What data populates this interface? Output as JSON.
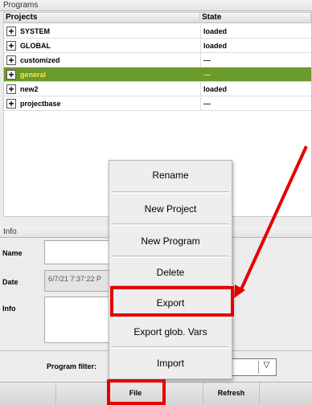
{
  "programs": {
    "title": "Programs",
    "columns": [
      "Projects",
      "State"
    ],
    "rows": [
      {
        "name": "SYSTEM",
        "state": "loaded",
        "selected": false
      },
      {
        "name": "GLOBAL",
        "state": "loaded",
        "selected": false
      },
      {
        "name": "customized",
        "state": "---",
        "selected": false
      },
      {
        "name": "general",
        "state": "---",
        "selected": true
      },
      {
        "name": "new2",
        "state": "loaded",
        "selected": false
      },
      {
        "name": "projectbase",
        "state": "---",
        "selected": false
      }
    ],
    "expander_symbol": "+"
  },
  "info": {
    "title": "Info",
    "name_label": "Name",
    "name_value": "",
    "date_label": "Date",
    "date_value": "6/7/21 7:37:22 P",
    "info_label": "Info",
    "info_value": ""
  },
  "filter": {
    "label": "Program filter:",
    "value": "",
    "arrow": "▽"
  },
  "toolbar": {
    "file_label": "File",
    "refresh_label": "Refresh"
  },
  "context_menu": {
    "items": [
      "Rename",
      "New Project",
      "New Program",
      "Delete",
      "Export",
      "Export glob. Vars",
      "Import"
    ]
  },
  "colors": {
    "selection": "#6a9a2a",
    "selection_text": "#ffe64a",
    "highlight": "#e60000"
  }
}
